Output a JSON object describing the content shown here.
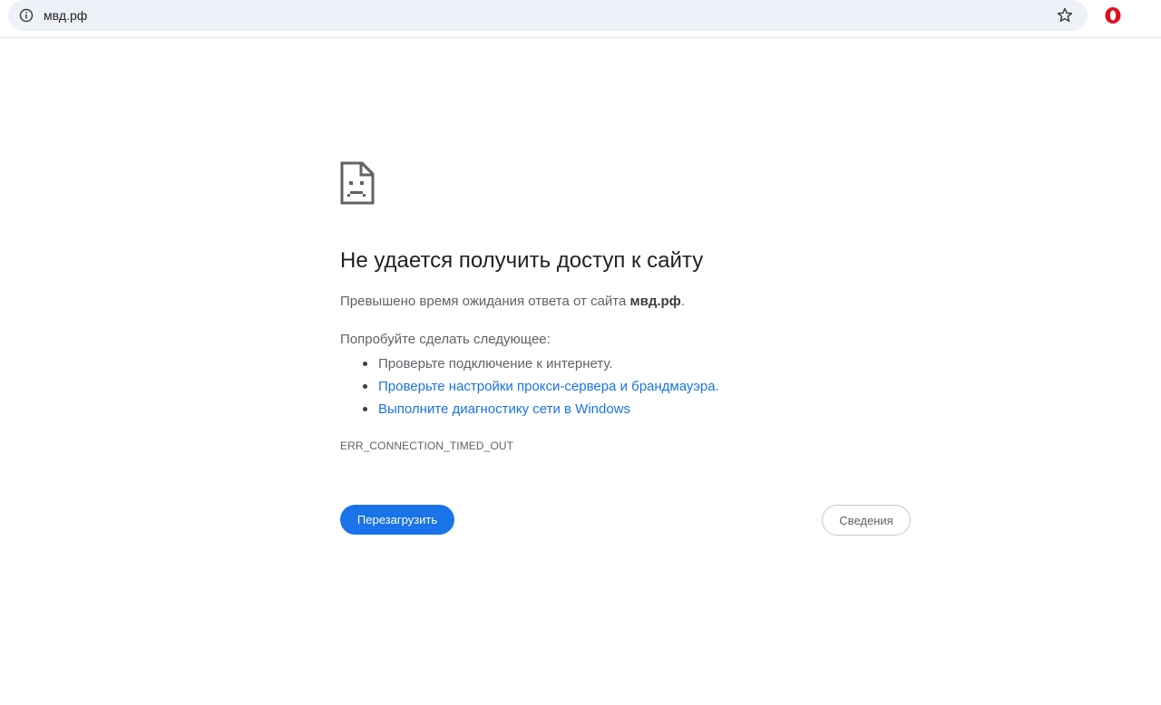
{
  "browser": {
    "url": "мвд.рф",
    "icons": {
      "site_info": "info-icon",
      "bookmark": "star-icon",
      "extension": "opera-icon"
    }
  },
  "error_page": {
    "icon": "sad-page-icon",
    "title": "Не удается получить доступ к сайту",
    "subtitle_prefix": "Превышено время ожидания ответа от сайта ",
    "subtitle_host": "мвд.рф",
    "subtitle_suffix": ".",
    "try_label": "Попробуйте сделать следующее:",
    "suggestions": [
      {
        "text": "Проверьте подключение к интернету.",
        "is_link": false
      },
      {
        "text": "Проверьте настройки прокси-сервера и брандмауэра.",
        "is_link": true
      },
      {
        "text": "Выполните диагностику сети в Windows",
        "is_link": true
      }
    ],
    "error_code": "ERR_CONNECTION_TIMED_OUT",
    "reload_label": "Перезагрузить",
    "details_label": "Сведения"
  },
  "colors": {
    "accent": "#1a73e8",
    "omnibox_bg": "#eef1f8",
    "opera_red": "#e0101a"
  }
}
